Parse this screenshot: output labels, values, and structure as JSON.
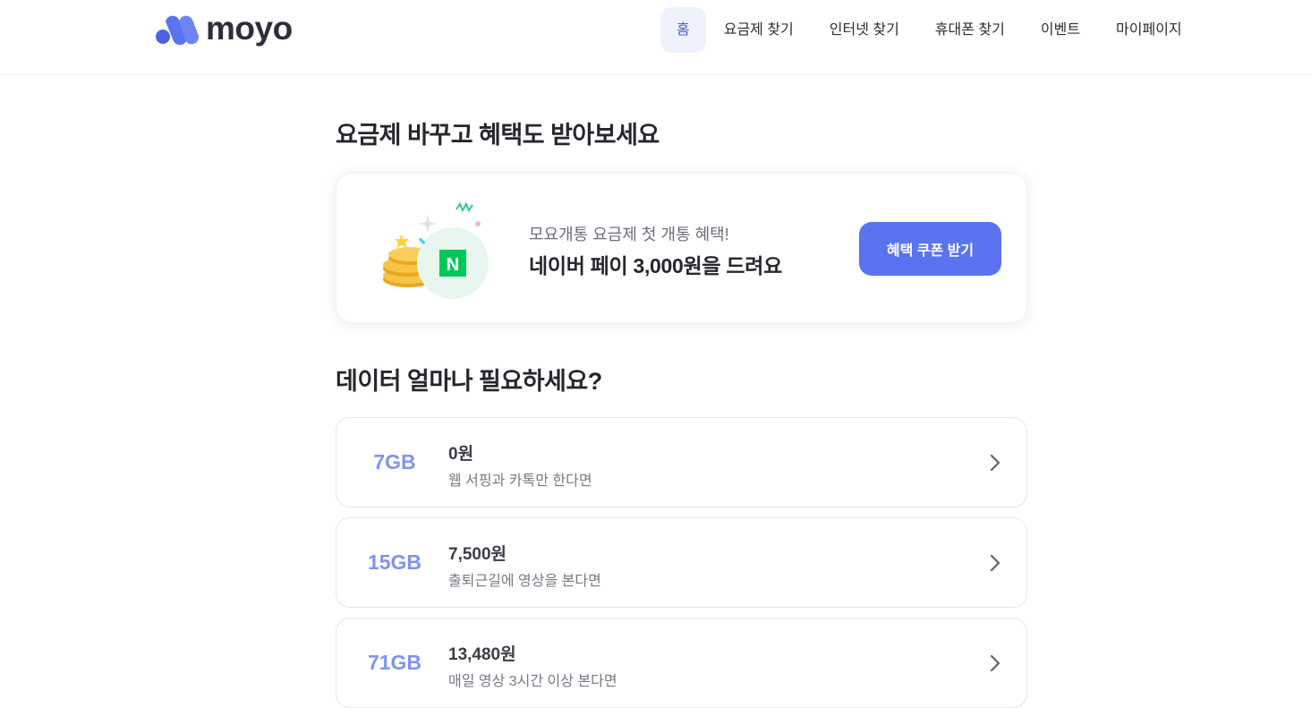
{
  "header": {
    "logo_text": "moyo",
    "nav": [
      {
        "label": "홈",
        "active": true
      },
      {
        "label": "요금제 찾기"
      },
      {
        "label": "인터넷 찾기"
      },
      {
        "label": "휴대폰 찾기"
      },
      {
        "label": "이벤트"
      },
      {
        "label": "마이페이지"
      }
    ]
  },
  "promo_section": {
    "title": "요금제 바꾸고 혜택도 받아보세요",
    "subtitle": "모요개통 요금제 첫 개통 혜택!",
    "headline": "네이버 페이 3,000원을 드려요",
    "button_label": "혜택 쿠폰 받기",
    "badge_letter": "N",
    "illustration": "coins-and-naverpay-badge"
  },
  "data_section": {
    "title": "데이터 얼마나 필요하세요?",
    "plans": [
      {
        "data": "7GB",
        "price": "0원",
        "desc": "웹 서핑과 카톡만 한다면"
      },
      {
        "data": "15GB",
        "price": "7,500원",
        "desc": "출퇴근길에 영상을 본다면"
      },
      {
        "data": "71GB",
        "price": "13,480원",
        "desc": "매일 영상 3시간 이상 본다면"
      }
    ]
  },
  "colors": {
    "accent": "#5a73f0",
    "gb_text": "#7f93ee",
    "nav_active_bg": "#eef2fd",
    "naver_green": "#03c75a"
  }
}
